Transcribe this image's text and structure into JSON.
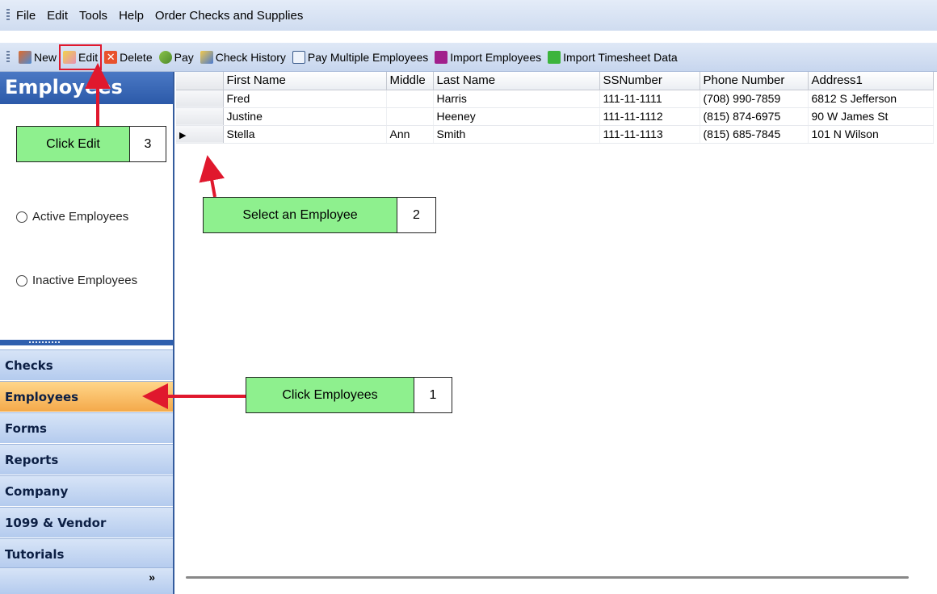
{
  "menubar": {
    "items": [
      {
        "label": "File",
        "underline": "F"
      },
      {
        "label": "Edit",
        "underline": "E"
      },
      {
        "label": "Tools",
        "underline": "T"
      },
      {
        "label": "Help",
        "underline": "H"
      },
      {
        "label": "Order Checks and Supplies",
        "underline": "O"
      }
    ]
  },
  "toolbar": {
    "new_label": "New",
    "edit_label": "Edit",
    "delete_label": "Delete",
    "pay_label": "Pay",
    "check_history_label": "Check History",
    "pay_multiple_label": "Pay Multiple Employees",
    "import_employees_label": "Import Employees",
    "import_timesheet_label": "Import Timesheet Data"
  },
  "nav": {
    "header": "Employees",
    "radio_active": "Active Employees",
    "radio_inactive": "Inactive Employees",
    "buttons": [
      "Checks",
      "Employees",
      "Forms",
      "Reports",
      "Company",
      "1099 & Vendor",
      "Tutorials"
    ],
    "active_button": "Employees",
    "footer_glyph": "»"
  },
  "grid": {
    "columns": [
      "First Name",
      "Middle",
      "Last Name",
      "SSNumber",
      "Phone Number",
      "Address1"
    ],
    "rows": [
      [
        "Fred",
        "",
        "Harris",
        "111-11-1111",
        "(708) 990-7859",
        "6812 S Jefferson"
      ],
      [
        "Justine",
        "",
        "Heeney",
        "111-11-1112",
        "(815) 874-6975",
        "90 W James St"
      ],
      [
        "Stella",
        "Ann",
        "Smith",
        "111-11-1113",
        "(815) 685-7845",
        "101 N Wilson"
      ]
    ],
    "current_row_marker": "▶"
  },
  "callouts": {
    "c1": {
      "label": "Click Employees",
      "num": "1"
    },
    "c2": {
      "label": "Select an Employee",
      "num": "2"
    },
    "c3": {
      "label": "Click Edit",
      "num": "3"
    }
  },
  "colors": {
    "callout_fill": "#8ef08e",
    "arrow": "#e0182d",
    "nav_header": "#2c5aa9",
    "nav_active": "#f4a94a"
  }
}
